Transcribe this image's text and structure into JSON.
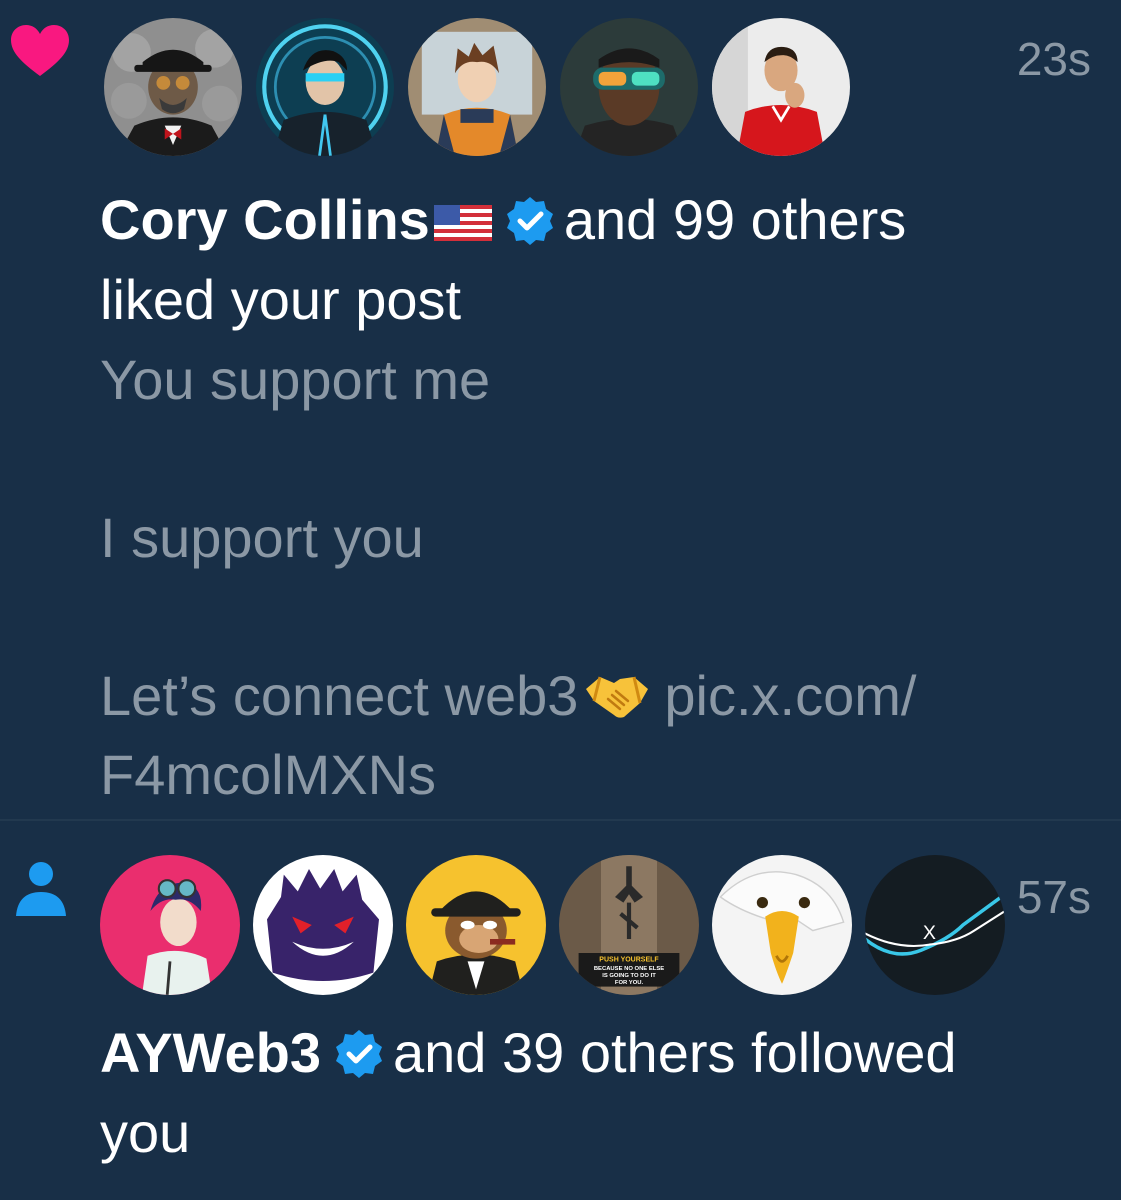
{
  "notifications": [
    {
      "type_icon": "heart-icon",
      "type_color": "#f91880",
      "avatars": [
        "avatar-gasmask-suit",
        "avatar-cyber-hero",
        "avatar-anime-jacket",
        "avatar-visor-man",
        "avatar-red-shirt-man"
      ],
      "time": "23s",
      "name": "Cory Collins",
      "flag": "us-flag-icon",
      "verified": true,
      "action_line": "and 99 others",
      "action_line2": "liked your post",
      "post_line1": "You support me",
      "post_line2": "I support you",
      "post_line3_before": "Let’s connect web3",
      "post_emoji": "handshake-icon",
      "post_link_a": "pic.x.com/",
      "post_link_b": "F4mcolMXNs"
    },
    {
      "type_icon": "person-icon",
      "type_color": "#1d9bf0",
      "avatars": [
        "avatar-anime-goggles",
        "avatar-gengar",
        "avatar-ape-hat",
        "avatar-push-yourself",
        "avatar-eagle",
        "avatar-x-chart"
      ],
      "avatar_text": "PUSH YOURSELF BECAUSE NO ONE ELSE IS GOING TO DO IT FOR YOU.",
      "avatar_x": "X",
      "time": "57s",
      "name": "AYWeb3",
      "verified": true,
      "action_line": "and 39 others followed",
      "action_line2": "you"
    }
  ],
  "colors": {
    "background": "#182f47",
    "primary_text": "#ffffff",
    "secondary_text": "#8b98a5",
    "verified": "#1d9bf0",
    "like": "#f91880"
  }
}
